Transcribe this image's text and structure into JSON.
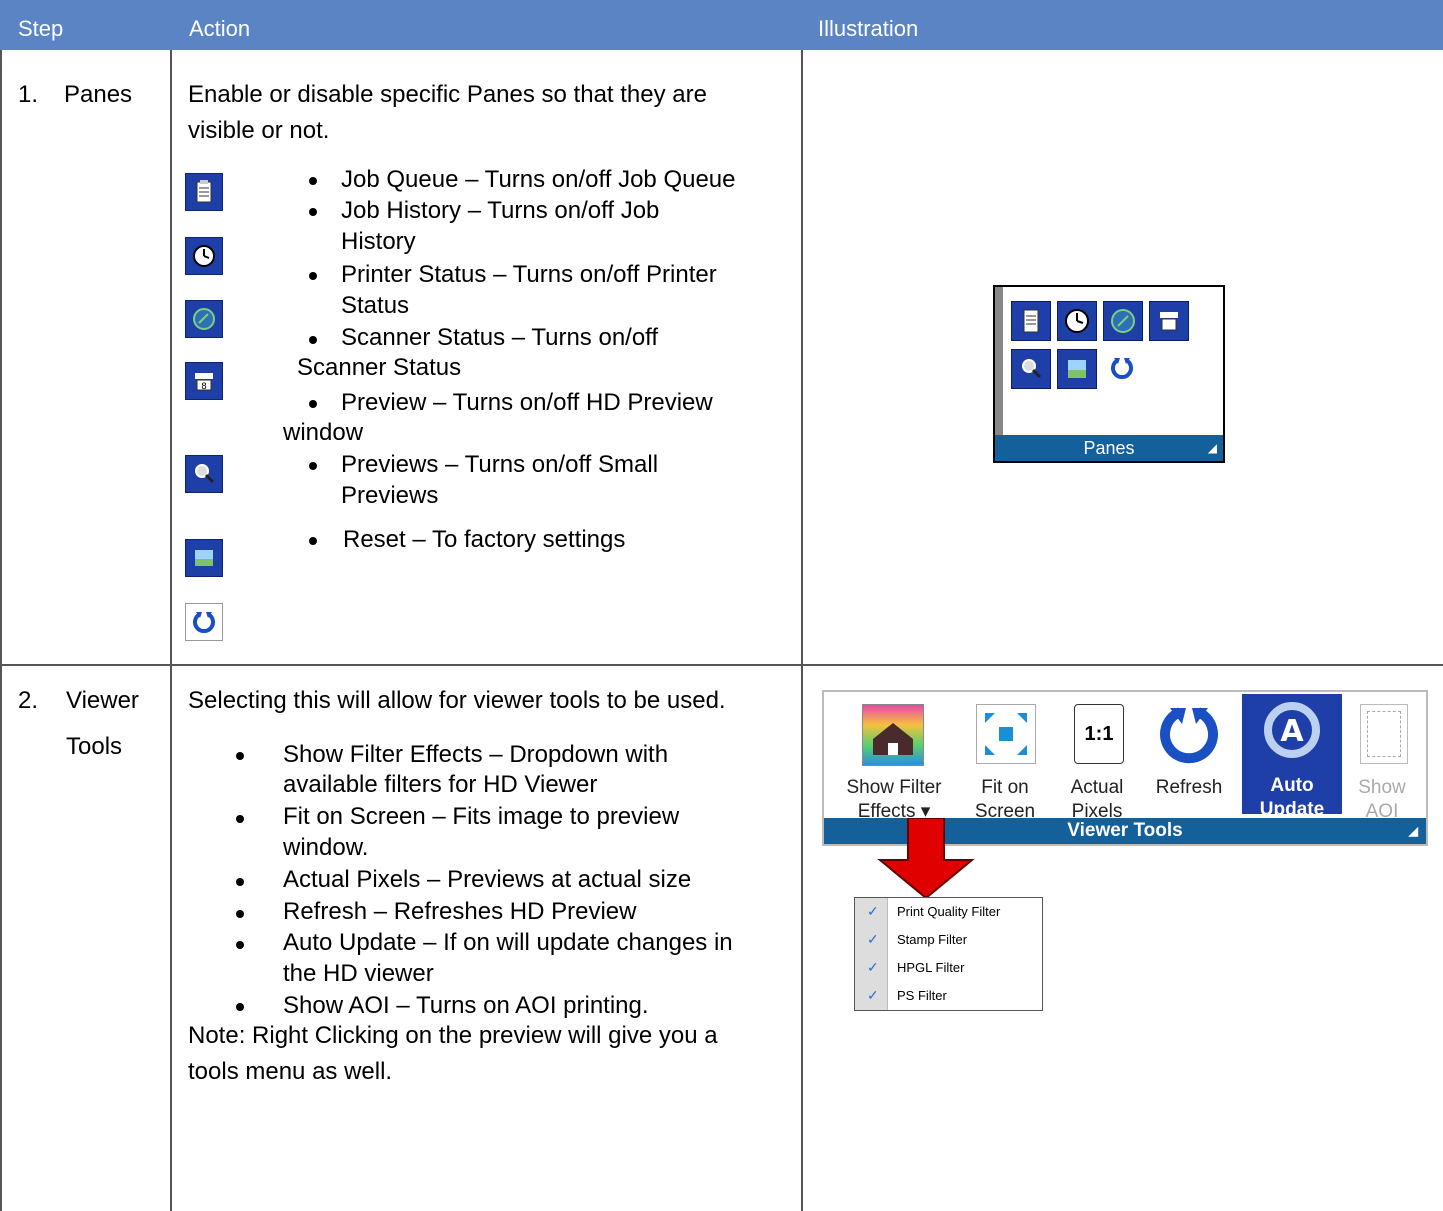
{
  "header": {
    "step": "Step",
    "action": "Action",
    "illustration": "Illustration"
  },
  "row1": {
    "num": "1.",
    "step": "Panes",
    "intro1": "Enable or disable specific Panes so that they are",
    "intro2": "visible or not.",
    "items": [
      "Job Queue – Turns on/off Job Queue",
      "Job History – Turns on/off Job",
      "History",
      "Printer Status – Turns on/off Printer",
      "Status",
      "Scanner Status – Turns on/off",
      "Scanner Status",
      "Preview – Turns on/off HD Preview",
      "window",
      "Previews – Turns on/off Small",
      "Previews",
      "Reset – To factory settings"
    ],
    "icons": [
      "clipboard-icon",
      "clock-icon",
      "scanner-status-icon",
      "printer-icon",
      "magnifier-icon",
      "image-icon",
      "reset-icon"
    ],
    "panes_footer": "Panes"
  },
  "row2": {
    "num": "2.",
    "step1": "Viewer",
    "step2": "Tools",
    "intro": "Selecting this will allow for viewer tools to be used.",
    "items": [
      "Show Filter Effects – Dropdown with",
      "available filters for HD Viewer",
      "Fit on Screen – Fits image to preview",
      "window.",
      "Actual Pixels – Previews at actual size",
      "Refresh – Refreshes HD Preview",
      "Auto Update – If on will update changes in",
      "the HD viewer",
      "Show AOI – Turns on AOI printing."
    ],
    "note1": "Note: Right Clicking on the preview will give you a",
    "note2": "tools menu as well.",
    "tools": {
      "show_filter_1": "Show Filter",
      "show_filter_2": "Effects ▾",
      "fit_1": "Fit on",
      "fit_2": "Screen",
      "actual_1": "Actual",
      "actual_2": "Pixels",
      "actual_icon": "1:1",
      "refresh": "Refresh",
      "auto_1": "Auto",
      "auto_2": "Update",
      "aoi_1": "Show",
      "aoi_2": "AOI",
      "footer": "Viewer Tools"
    },
    "menu": [
      "Print Quality Filter",
      "Stamp Filter",
      "HPGL Filter",
      "PS Filter"
    ],
    "accent": "#13609a",
    "arrow_color": "#e00000"
  }
}
